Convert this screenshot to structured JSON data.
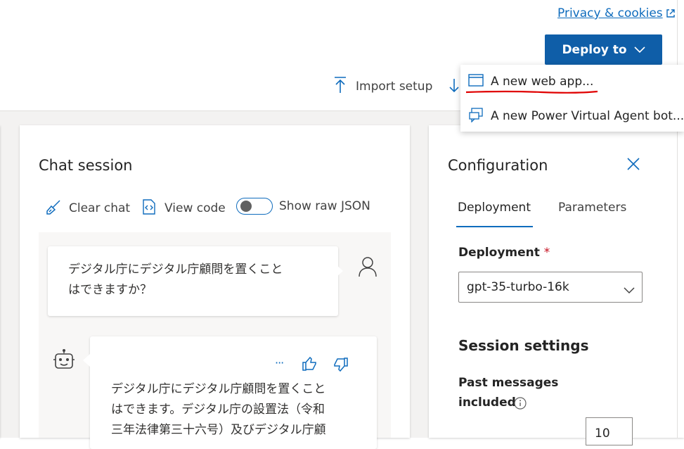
{
  "header": {
    "privacy_link": "Privacy & cookies",
    "deploy_button": "Deploy to",
    "import_setup": "Import setup"
  },
  "deploy_menu": {
    "items": [
      {
        "label": "A new web app..."
      },
      {
        "label": "A new Power Virtual Agent bot..."
      }
    ]
  },
  "chat": {
    "title": "Chat session",
    "clear_chat": "Clear chat",
    "view_code": "View code",
    "show_raw_json": "Show raw JSON",
    "user_message_line1": "デジタル庁にデジタル庁顧問を置くこと",
    "user_message_line2": "はできますか？",
    "assistant_more": "···",
    "assistant_line1": "デジタル庁にデジタル庁顧問を置くこと",
    "assistant_line2": "はできます。デジタル庁の設置法（令和",
    "assistant_line3": "三年法律第三十六号）及びデジタル庁顧"
  },
  "config": {
    "title": "Configuration",
    "tabs": [
      "Deployment",
      "Parameters"
    ],
    "active_tab": "Deployment",
    "deployment_label": "Deployment",
    "required_mark": "*",
    "deployment_value": "gpt-35-turbo-16k",
    "session_settings": "Session settings",
    "past_messages_line1": "Past messages",
    "past_messages_line2": "included",
    "past_messages_value": "10"
  },
  "colors": {
    "accent": "#0f6cbd",
    "button_bg": "#0f5ea8",
    "annotation_red": "#e00000"
  }
}
